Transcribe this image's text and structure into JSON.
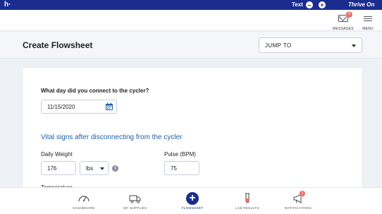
{
  "topbar": {
    "logo": "h·",
    "text_size_label": "Text",
    "decrease_symbol": "–",
    "increase_symbol": "+",
    "brand": "Thrive On",
    "colors": {
      "topbar_bg": "#1a2d8f"
    }
  },
  "header": {
    "messages": {
      "label": "MESSAGES",
      "badge_count": "3"
    },
    "menu": {
      "label": "MENU"
    }
  },
  "page": {
    "title": "Create Flowsheet",
    "jump_to": {
      "label": "JUMP TO"
    }
  },
  "form": {
    "question": "What day did you connect to the cycler?",
    "date_value": "11/15/2020",
    "section_title": "Vital signs after disconnecting from the cycler",
    "daily_weight": {
      "label": "Daily Weight",
      "value": "176",
      "unit": "lbs"
    },
    "pulse": {
      "label": "Pulse (BPM)",
      "value": "75"
    },
    "temperature": {
      "label": "Temperature"
    },
    "colors": {
      "section_title": "#1f5fa8"
    }
  },
  "bottom_nav": {
    "items": [
      {
        "label": "DASHBOARD",
        "icon": "speedometer-icon"
      },
      {
        "label": "MY SUPPLIES",
        "icon": "truck-icon"
      },
      {
        "label": "FLOWSHEET",
        "icon": "plus-circle-icon",
        "active": true
      },
      {
        "label": "LAB RESULTS",
        "icon": "test-tube-icon"
      },
      {
        "label": "NOTIFICATIONS",
        "icon": "megaphone-icon",
        "badge_count": "1"
      }
    ]
  }
}
